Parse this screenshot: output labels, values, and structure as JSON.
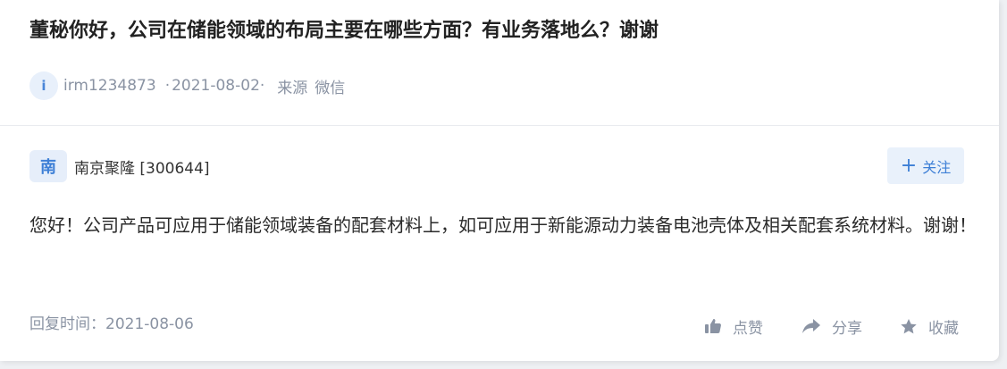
{
  "question": {
    "title": "董秘你好，公司在储能领域的布局主要在哪些方面？有业务落地么？谢谢",
    "asker_avatar_letter": "i",
    "asker": "irm1234873",
    "date": "2021-08-02",
    "dot_before": "·",
    "dot_after": "·",
    "source_label": "来源",
    "source_value": "微信"
  },
  "answer": {
    "company_avatar_char": "南",
    "company_name": "南京聚隆 [300644]",
    "follow_label": "关注",
    "follow_icon": "+",
    "text": "您好！公司产品可应用于储能领域装备的配套材料上，如可应用于新能源动力装备电池壳体及相关配套系统材料。谢谢！",
    "reply_time": "回复时间：2021-08-06",
    "actions": {
      "like": "点赞",
      "share": "分享",
      "favorite": "收藏"
    }
  },
  "colors": {
    "accent": "#3d7fd6",
    "follow_bg": "#e9f1fb",
    "muted_text": "#8a93a3",
    "title_text": "#222222"
  },
  "icons": {
    "like": "thumbs-up-icon",
    "share": "share-arrow-icon",
    "favorite": "star-icon"
  }
}
